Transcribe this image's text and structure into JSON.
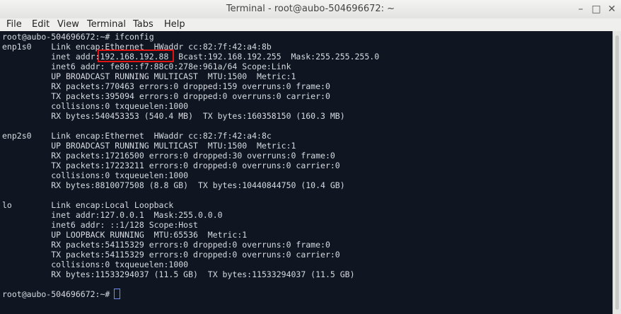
{
  "window": {
    "title": "Terminal - root@aubo-504696672: ~"
  },
  "menu": [
    "File",
    "Edit",
    "View",
    "Terminal",
    "Tabs",
    "Help"
  ],
  "terminal": {
    "lines": [
      "root@aubo-504696672:~# ifconfig",
      "enp1s0    Link encap:Ethernet  HWaddr cc:82:7f:42:a4:8b",
      "          inet addr:192.168.192.88  Bcast:192.168.192.255  Mask:255.255.255.0",
      "          inet6 addr: fe80::f7:88c0:278e:961a/64 Scope:Link",
      "          UP BROADCAST RUNNING MULTICAST  MTU:1500  Metric:1",
      "          RX packets:770463 errors:0 dropped:159 overruns:0 frame:0",
      "          TX packets:395094 errors:0 dropped:0 overruns:0 carrier:0",
      "          collisions:0 txqueuelen:1000",
      "          RX bytes:540453353 (540.4 MB)  TX bytes:160358150 (160.3 MB)",
      "",
      "enp2s0    Link encap:Ethernet  HWaddr cc:82:7f:42:a4:8c",
      "          UP BROADCAST RUNNING MULTICAST  MTU:1500  Metric:1",
      "          RX packets:17216500 errors:0 dropped:30 overruns:0 frame:0",
      "          TX packets:17223211 errors:0 dropped:0 overruns:0 carrier:0",
      "          collisions:0 txqueuelen:1000",
      "          RX bytes:8810077508 (8.8 GB)  TX bytes:10440844750 (10.4 GB)",
      "",
      "lo        Link encap:Local Loopback",
      "          inet addr:127.0.0.1  Mask:255.0.0.0",
      "          inet6 addr: ::1/128 Scope:Host",
      "          UP LOOPBACK RUNNING  MTU:65536  Metric:1",
      "          RX packets:54115329 errors:0 dropped:0 overruns:0 frame:0",
      "          TX packets:54115329 errors:0 dropped:0 overruns:0 carrier:0",
      "          collisions:0 txqueuelen:1000",
      "          RX bytes:11533294037 (11.5 GB)  TX bytes:11533294037 (11.5 GB)",
      "",
      "root@aubo-504696672:~# "
    ],
    "highlight_color": "#e11414"
  }
}
